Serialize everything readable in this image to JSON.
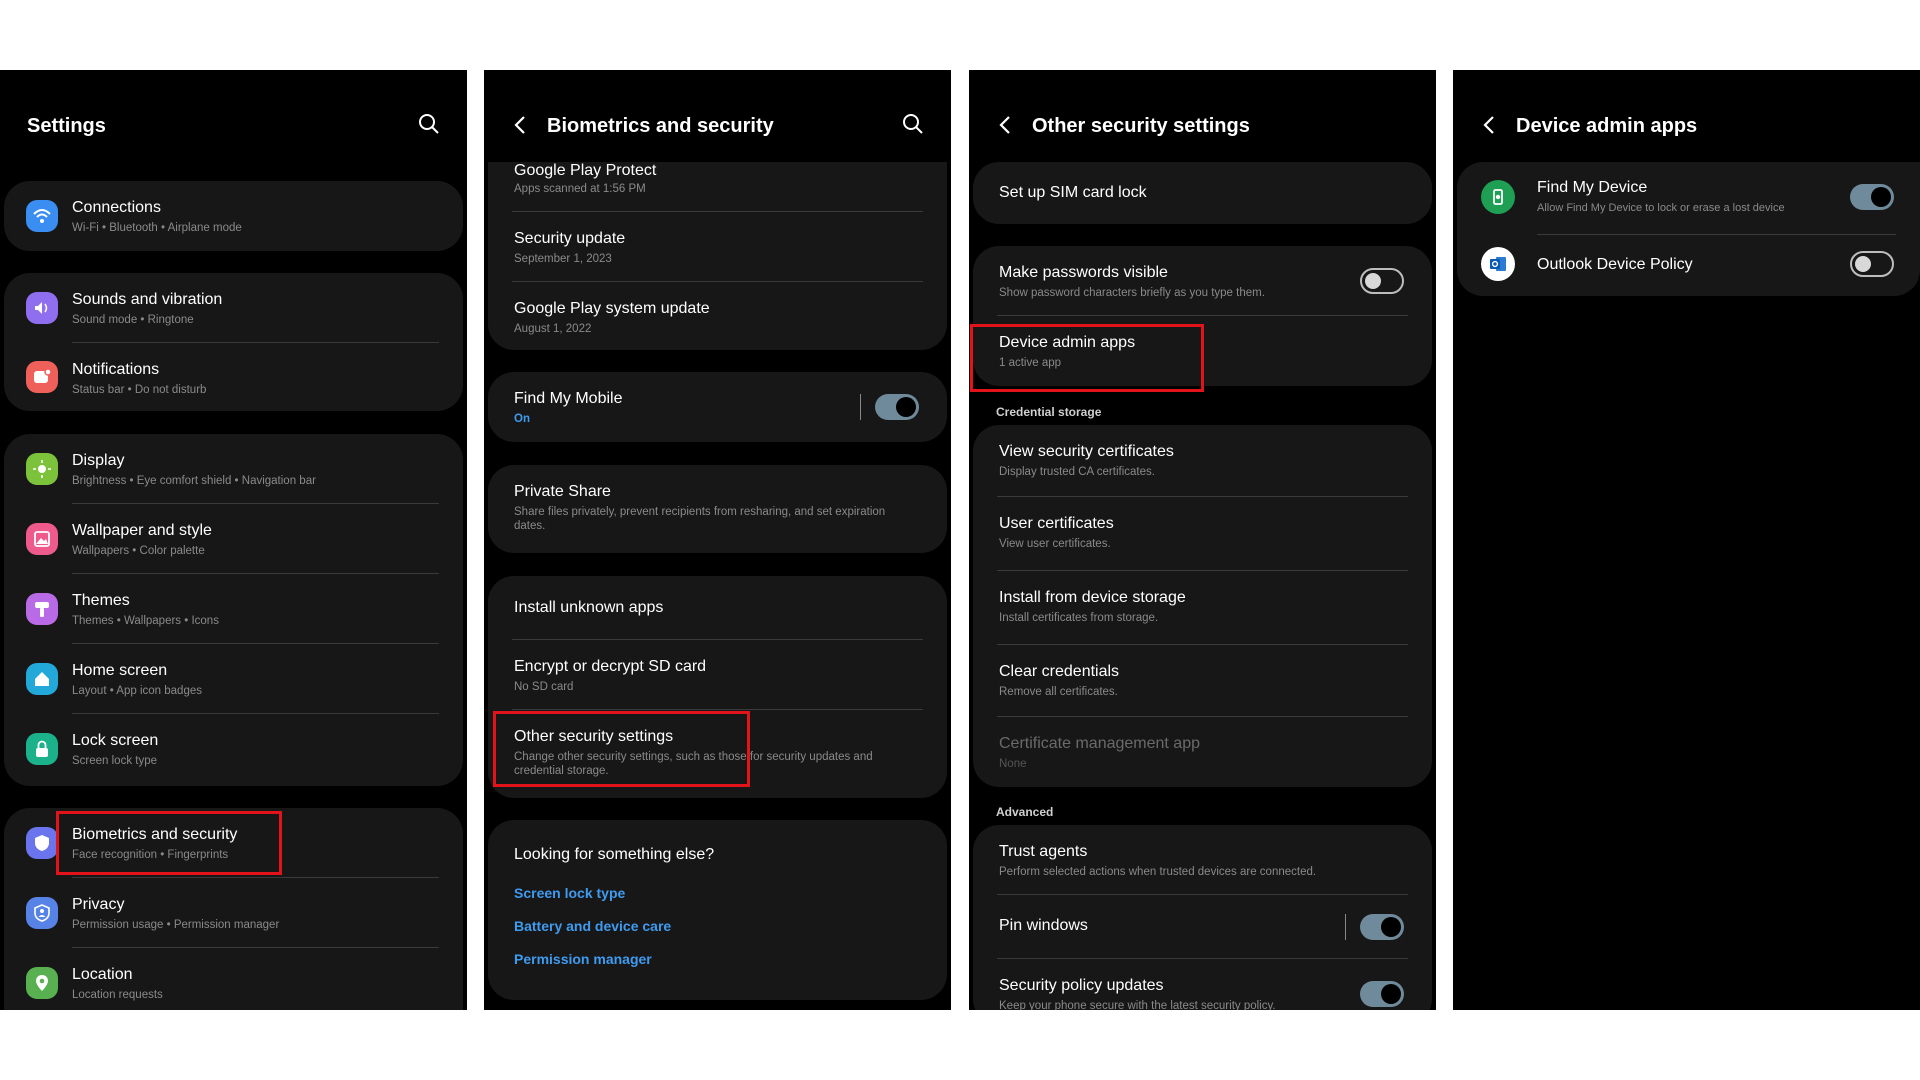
{
  "panel1": {
    "title": "Settings",
    "items": [
      {
        "title": "Connections",
        "sub": "Wi-Fi  •  Bluetooth  •  Airplane mode",
        "icon": "wifi-icon",
        "color": "#3a8ef2"
      },
      {
        "title": "Sounds and vibration",
        "sub": "Sound mode  •  Ringtone",
        "icon": "sound-icon",
        "color": "#8f6ef0"
      },
      {
        "title": "Notifications",
        "sub": "Status bar  •  Do not disturb",
        "icon": "notification-icon",
        "color": "#f0605a"
      },
      {
        "title": "Display",
        "sub": "Brightness  •  Eye comfort shield  •  Navigation bar",
        "icon": "brightness-icon",
        "color": "#7cc23a"
      },
      {
        "title": "Wallpaper and style",
        "sub": "Wallpapers  •  Color palette",
        "icon": "wallpaper-icon",
        "color": "#ee5a8c"
      },
      {
        "title": "Themes",
        "sub": "Themes  •  Wallpapers  •  Icons",
        "icon": "theme-icon",
        "color": "#b96ae6"
      },
      {
        "title": "Home screen",
        "sub": "Layout  •  App icon badges",
        "icon": "home-icon",
        "color": "#22a9d9"
      },
      {
        "title": "Lock screen",
        "sub": "Screen lock type",
        "icon": "lock-icon",
        "color": "#1bb28b"
      },
      {
        "title": "Biometrics and security",
        "sub": "Face recognition  •  Fingerprints",
        "icon": "shield-icon",
        "color": "#6a74ec"
      },
      {
        "title": "Privacy",
        "sub": "Permission usage  •  Permission manager",
        "icon": "privacy-icon",
        "color": "#5883e6"
      },
      {
        "title": "Location",
        "sub": "Location requests",
        "icon": "location-icon",
        "color": "#59b050"
      }
    ]
  },
  "panel2": {
    "title": "Biometrics and security",
    "items": [
      {
        "title": "Google Play Protect",
        "sub": "Apps scanned at 1:56 PM"
      },
      {
        "title": "Security update",
        "sub": "September 1, 2023"
      },
      {
        "title": "Google Play system update",
        "sub": "August 1, 2022"
      },
      {
        "title": "Find My Mobile",
        "sub": "On"
      },
      {
        "title": "Private Share",
        "sub": "Share files privately, prevent recipients from resharing, and set expiration dates."
      },
      {
        "title": "Install unknown apps",
        "sub": ""
      },
      {
        "title": "Encrypt or decrypt SD card",
        "sub": "No SD card"
      },
      {
        "title": "Other security settings",
        "sub": "Change other security settings, such as those for security updates and credential storage."
      }
    ],
    "looking": {
      "title": "Looking for something else?",
      "links": [
        "Screen lock type",
        "Battery and device care",
        "Permission manager"
      ]
    }
  },
  "panel3": {
    "title": "Other security settings",
    "items": [
      {
        "title": "Set up SIM card lock",
        "sub": ""
      },
      {
        "title": "Make passwords visible",
        "sub": "Show password characters briefly as you type them."
      },
      {
        "title": "Device admin apps",
        "sub": "1 active app"
      },
      {
        "title": "View security certificates",
        "sub": "Display trusted CA certificates."
      },
      {
        "title": "User certificates",
        "sub": "View user certificates."
      },
      {
        "title": "Install from device storage",
        "sub": "Install certificates from storage."
      },
      {
        "title": "Clear credentials",
        "sub": "Remove all certificates."
      },
      {
        "title": "Certificate management app",
        "sub": "None"
      },
      {
        "title": "Trust agents",
        "sub": "Perform selected actions when trusted devices are connected."
      },
      {
        "title": "Pin windows",
        "sub": ""
      },
      {
        "title": "Security policy updates",
        "sub": "Keep your phone secure with the latest security policy."
      }
    ],
    "sections": {
      "credential": "Credential storage",
      "advanced": "Advanced"
    }
  },
  "panel4": {
    "title": "Device admin apps",
    "items": [
      {
        "title": "Find My Device",
        "sub": "Allow Find My Device to lock or erase a lost device",
        "icon": "find-my-device-icon"
      },
      {
        "title": "Outlook Device Policy",
        "sub": "",
        "icon": "outlook-icon"
      }
    ]
  },
  "toggles": {
    "find_my_mobile": true,
    "make_passwords_visible": false,
    "pin_windows": true,
    "security_policy_updates": true,
    "find_my_device": true,
    "outlook_device_policy": false
  },
  "colors": {
    "highlight": "#e3131b",
    "link": "#3e9bf0",
    "card": "#171717"
  }
}
